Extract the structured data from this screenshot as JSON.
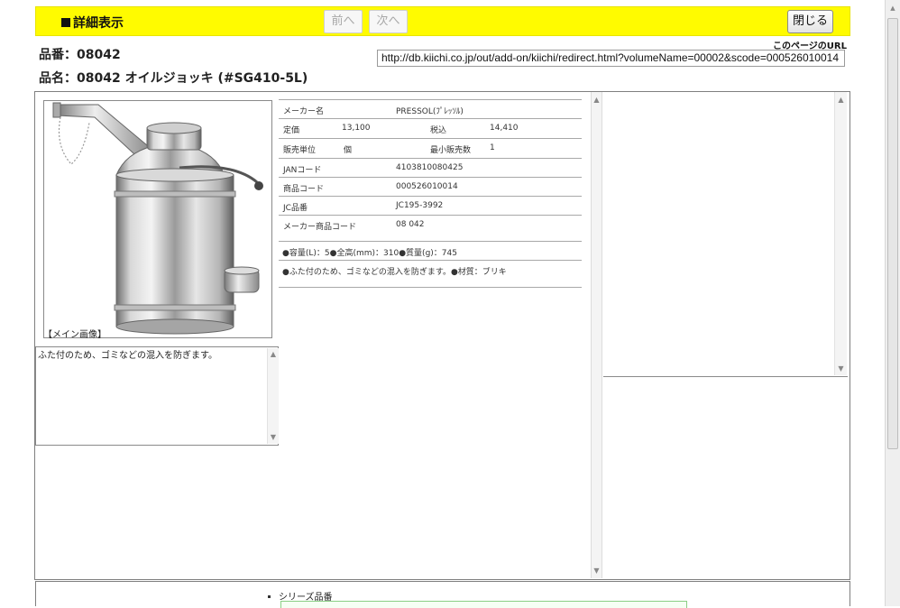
{
  "header": {
    "title": "詳細表示",
    "prev_label": "前へ",
    "next_label": "次へ",
    "close_label": "閉じる"
  },
  "product": {
    "number_line": "品番：08042",
    "name_line": "品名：08042 オイルジョッキ (#SG410-5L)"
  },
  "page_url": {
    "label": "このページのURL",
    "value": "http://db.kiichi.co.jp/out/add-on/kiichi/redirect.html?volumeName=00002&scode=000526010014"
  },
  "image": {
    "caption": "【メイン画像】"
  },
  "description": {
    "text": "ふた付のため、ゴミなどの混入を防ぎます。"
  },
  "spec": {
    "maker_label": "メーカー名",
    "maker_value": "PRESSOL(ﾌﾟﾚｯｿﾙ)",
    "list_price_label": "定価",
    "list_price_value": "13,100",
    "tax_in_label": "税込",
    "tax_in_value": "14,410",
    "sales_unit_label": "販売単位",
    "sales_unit_value": "個",
    "min_qty_label": "最小販売数",
    "min_qty_value": "1",
    "jan_label": "JANコード",
    "jan_value": "4103810080425",
    "product_code_label": "商品コード",
    "product_code_value": "000526010014",
    "jc_label": "JC品番",
    "jc_value": "JC195-3992",
    "maker_code_label": "メーカー商品コード",
    "maker_code_value": "08 042",
    "note1": "●容量(L)：5●全高(mm)：310●質量(g)：745",
    "note2": "●ふた付のため、ゴミなどの混入を防ぎます。●材質：ブリキ"
  },
  "footer": {
    "series_label": "シリーズ品番"
  }
}
